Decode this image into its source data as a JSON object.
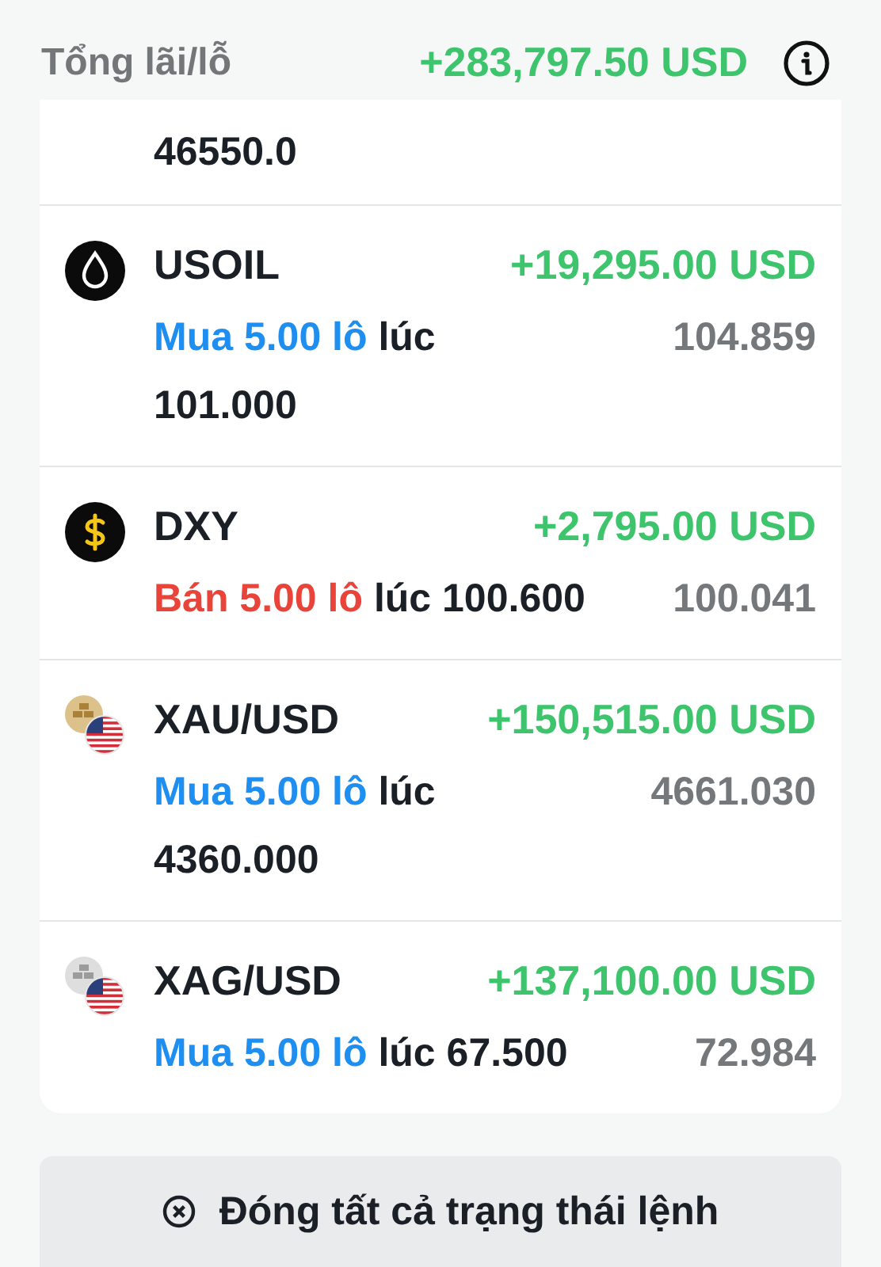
{
  "summary": {
    "label": "Tổng lãi/lỗ",
    "total": "+283,797.50 USD"
  },
  "partial_row": {
    "entry": "46550.0"
  },
  "positions": [
    {
      "kind": "oil",
      "symbol": "USOIL",
      "profit": "+19,295.00 USD",
      "color": "#1e8ef0",
      "side_text": "Mua 5.00 lô",
      "at": "lúc",
      "entry": "101.000",
      "current": "104.859"
    },
    {
      "kind": "dollar",
      "symbol": "DXY",
      "profit": "+2,795.00 USD",
      "color": "#e9443a",
      "side_text": "Bán 5.00 lô",
      "at": "lúc",
      "entry": "100.600",
      "current": "100.041"
    },
    {
      "kind": "gold",
      "symbol": "XAU/USD",
      "profit": "+150,515.00 USD",
      "color": "#1e8ef0",
      "side_text": "Mua 5.00 lô",
      "at": "lúc",
      "entry": "4360.000",
      "current": "4661.030"
    },
    {
      "kind": "silver",
      "symbol": "XAG/USD",
      "profit": "+137,100.00 USD",
      "color": "#1e8ef0",
      "side_text": "Mua 5.00 lô",
      "at": "lúc",
      "entry": "67.500",
      "current": "72.984"
    }
  ],
  "close_all_button": {
    "label": "Đóng tất cả trạng thái lệnh"
  }
}
